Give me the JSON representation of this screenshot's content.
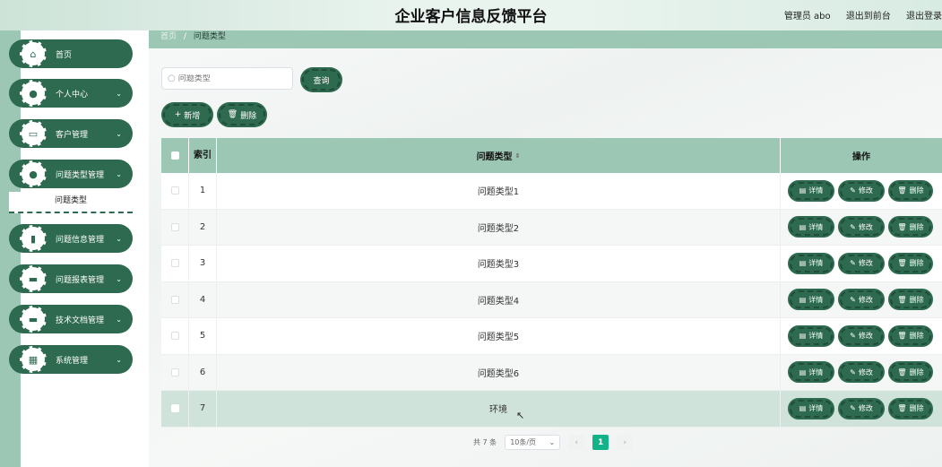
{
  "header": {
    "title": "企业客户信息反馈平台",
    "user": "管理员 abo",
    "back_to_console": "退出到前台",
    "logout": "退出登录"
  },
  "sidebar": {
    "items": [
      {
        "label": "首页",
        "icon": "home-icon",
        "glyph": "⌂"
      },
      {
        "label": "个人中心",
        "icon": "user-icon",
        "glyph": "●"
      },
      {
        "label": "客户管理",
        "icon": "monitor-icon",
        "glyph": "▭"
      },
      {
        "label": "问题类型管理",
        "icon": "user-icon",
        "glyph": "●"
      },
      {
        "label": "问题信息管理",
        "icon": "chart-icon",
        "glyph": "▮"
      },
      {
        "label": "问题报表管理",
        "icon": "message-icon",
        "glyph": "▬"
      },
      {
        "label": "技术文档管理",
        "icon": "ticket-icon",
        "glyph": "▬"
      },
      {
        "label": "系统管理",
        "icon": "grid-icon",
        "glyph": "▦"
      }
    ],
    "submenu_active": "问题类型"
  },
  "breadcrumb": {
    "home": "首页",
    "separator": "/",
    "current": "问题类型"
  },
  "search": {
    "placeholder": "问题类型",
    "query_button": "查询"
  },
  "toolbar": {
    "add_label": "新增",
    "delete_label": "删除"
  },
  "table": {
    "headers": {
      "index": "索引",
      "type": "问题类型",
      "ops": "操作"
    },
    "rows": [
      {
        "index": "1",
        "type": "问题类型1"
      },
      {
        "index": "2",
        "type": "问题类型2"
      },
      {
        "index": "3",
        "type": "问题类型3"
      },
      {
        "index": "4",
        "type": "问题类型4"
      },
      {
        "index": "5",
        "type": "问题类型5"
      },
      {
        "index": "6",
        "type": "问题类型6"
      },
      {
        "index": "7",
        "type": "环境"
      }
    ],
    "row_actions": {
      "detail": "详情",
      "edit": "修改",
      "delete": "删除"
    }
  },
  "pagination": {
    "total": "共 7 条",
    "page_size": "10条/页",
    "current_page": "1"
  },
  "colors": {
    "primary": "#2d6a4f",
    "accent": "#9dc7b5",
    "highlight_row": "#cfe3da",
    "page_active": "#13b38a"
  }
}
